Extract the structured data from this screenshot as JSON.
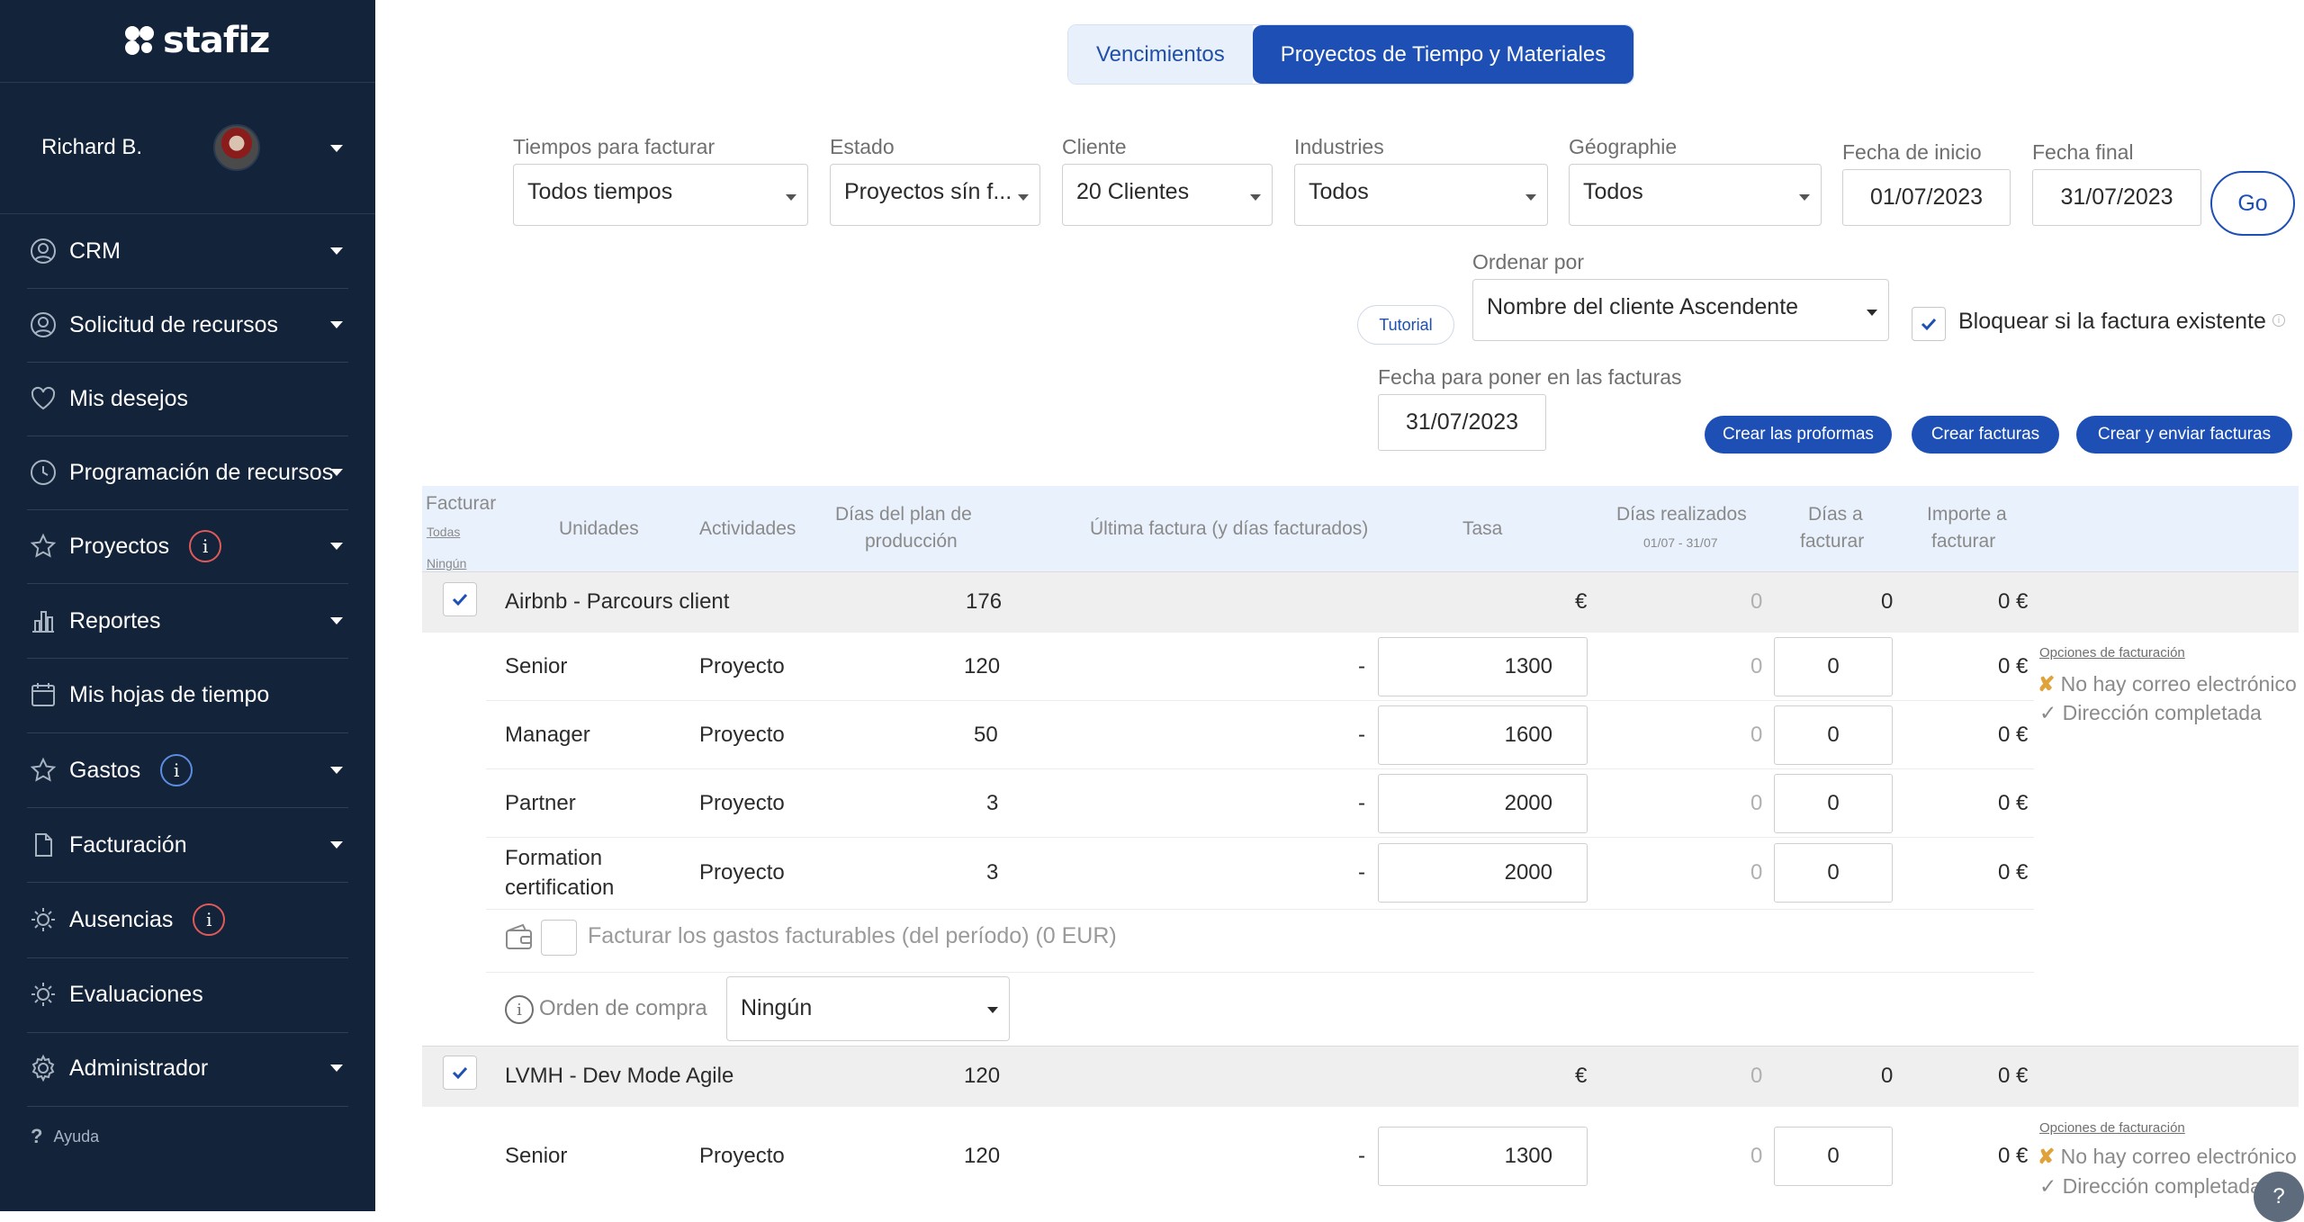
{
  "app": {
    "logo_text": "stafiz"
  },
  "user": {
    "name": "Richard B."
  },
  "sidebar": {
    "items": [
      {
        "label": "CRM"
      },
      {
        "label": "Solicitud de recursos"
      },
      {
        "label": "Mis desejos"
      },
      {
        "label": "Programación de recursos"
      },
      {
        "label": "Proyectos",
        "info": "i"
      },
      {
        "label": "Reportes"
      },
      {
        "label": "Mis hojas de tiempo"
      },
      {
        "label": "Gastos",
        "info": "i"
      },
      {
        "label": "Facturación"
      },
      {
        "label": "Ausencias",
        "info": "i"
      },
      {
        "label": "Evaluaciones"
      },
      {
        "label": "Administrador"
      }
    ],
    "help": "Ayuda"
  },
  "tabs": [
    {
      "label": "Vencimientos",
      "active": false
    },
    {
      "label": "Proyectos de Tiempo y Materiales",
      "active": true
    }
  ],
  "filters": {
    "tiempos": {
      "label": "Tiempos para facturar",
      "value": "Todos tiempos"
    },
    "estado": {
      "label": "Estado",
      "value": "Proyectos sín f..."
    },
    "cliente": {
      "label": "Cliente",
      "value": "20 Clientes"
    },
    "industrias": {
      "label": "Industries",
      "value": "Todos"
    },
    "geographie": {
      "label": "Géographie",
      "value": "Todos"
    },
    "fecha_inicio": {
      "label": "Fecha de inicio",
      "value": "01/07/2023"
    },
    "fecha_final": {
      "label": "Fecha final",
      "value": "31/07/2023"
    },
    "go": "Go",
    "ordenar": {
      "label": "Ordenar por",
      "value": "Nombre del cliente Ascendente"
    },
    "tutorial": "Tutorial",
    "bloquear": "Bloquear si la factura existente",
    "fecha_facturas": {
      "label": "Fecha para poner en las facturas",
      "value": "31/07/2023"
    }
  },
  "actions": {
    "proformas": "Crear las proformas",
    "facturas": "Crear facturas",
    "enviar": "Crear y enviar facturas"
  },
  "table": {
    "headers": {
      "facturar": "Facturar",
      "todas": "Todas",
      "ningun": "Ningún",
      "unidades": "Unidades",
      "actividades": "Actividades",
      "dias_plan_1": "Días del plan de",
      "dias_plan_2": "producción",
      "ultima": "Última factura (y días facturados)",
      "tasa": "Tasa",
      "dias_realizados": "Días realizados",
      "periodo": "01/07 - 31/07",
      "dias_facturar_1": "Días a",
      "dias_facturar_2": "facturar",
      "importe_1": "Importe a",
      "importe_2": "facturar"
    },
    "groups": [
      {
        "name": "Airbnb - Parcours client",
        "plan": "176",
        "currency": "€",
        "realizados": "0",
        "a_facturar": "0",
        "importe": "0 €",
        "rows": [
          {
            "unit": "Senior",
            "activity": "Proyecto",
            "plan": "120",
            "last": "-",
            "rate": "1300",
            "done": "0",
            "days": "0",
            "amount": "0 €"
          },
          {
            "unit": "Manager",
            "activity": "Proyecto",
            "plan": "50",
            "last": "-",
            "rate": "1600",
            "done": "0",
            "days": "0",
            "amount": "0 €"
          },
          {
            "unit": "Partner",
            "activity": "Proyecto",
            "plan": "3",
            "last": "-",
            "rate": "2000",
            "done": "0",
            "days": "0",
            "amount": "0 €"
          },
          {
            "unit_1": "Formation",
            "unit_2": "certification",
            "activity": "Proyecto",
            "plan": "3",
            "last": "-",
            "rate": "2000",
            "done": "0",
            "days": "0",
            "amount": "0 €"
          }
        ],
        "options": {
          "title": "Opciones de facturación",
          "no_email": "No hay correo electrónico",
          "address": "Dirección completada"
        },
        "expenses": "Facturar los gastos facturables (del período) (0 EUR)",
        "purchase_order": {
          "label": "Orden de compra",
          "value": "Ningún"
        }
      },
      {
        "name": "LVMH - Dev Mode Agile",
        "plan": "120",
        "currency": "€",
        "realizados": "0",
        "a_facturar": "0",
        "importe": "0 €",
        "rows": [
          {
            "unit": "Senior",
            "activity": "Proyecto",
            "plan": "120",
            "last": "-",
            "rate": "1300",
            "done": "0",
            "days": "0",
            "amount": "0 €"
          }
        ],
        "options": {
          "title": "Opciones de facturación",
          "no_email": "No hay correo electrónico",
          "address": "Dirección completada"
        }
      }
    ]
  },
  "colors": {
    "sidebar_bg": "#13233a",
    "accent": "#1d4fb5",
    "header_bg": "#e9f1fc",
    "group_bg": "#efefef"
  }
}
